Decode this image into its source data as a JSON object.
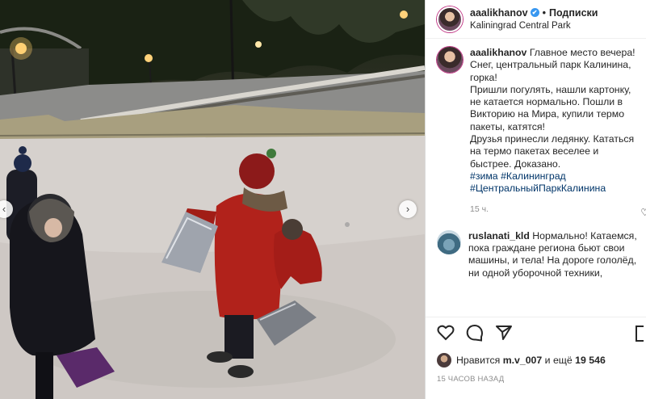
{
  "header": {
    "username": "aaalikhanov",
    "verified_mark": "✔",
    "separator": "•",
    "follow_label": "Подписки",
    "location": "Kaliningrad Central Park"
  },
  "caption": {
    "username": "aaalikhanov",
    "lines": [
      "Главное место вечера! Снег, центральный парк Калинина, горка!",
      "Пришли погулять, нашли картонку, не катается нормально. Пошли в Викторию на Мира, купили термо пакеты, катятся!",
      "Друзья принесли ледянку. Кататься на термо пакетах веселее и быстрее. Доказано."
    ],
    "hashtags": [
      "#зима",
      "#Калининград",
      "#ЦентральныйПаркКалинина"
    ],
    "time": "15 ч."
  },
  "comment": {
    "username": "ruslanati_kld",
    "text": "Нормально! Катаемся, пока граждане региона бьют свои машины, и тела! На дороге гололёд, ни одной уборочной техники,"
  },
  "actions": {
    "like_icon": "heart-icon",
    "comment_icon": "comment-icon",
    "share_icon": "share-icon",
    "save_icon": "bookmark-icon"
  },
  "likes": {
    "prefix": "Нравится",
    "user": "m.v_007",
    "conj": "и ещё",
    "count": "19 546"
  },
  "timestamp": "15 ЧАСОВ НАЗАД",
  "photo": {
    "prev_arrow": "‹",
    "next_arrow": "›"
  }
}
